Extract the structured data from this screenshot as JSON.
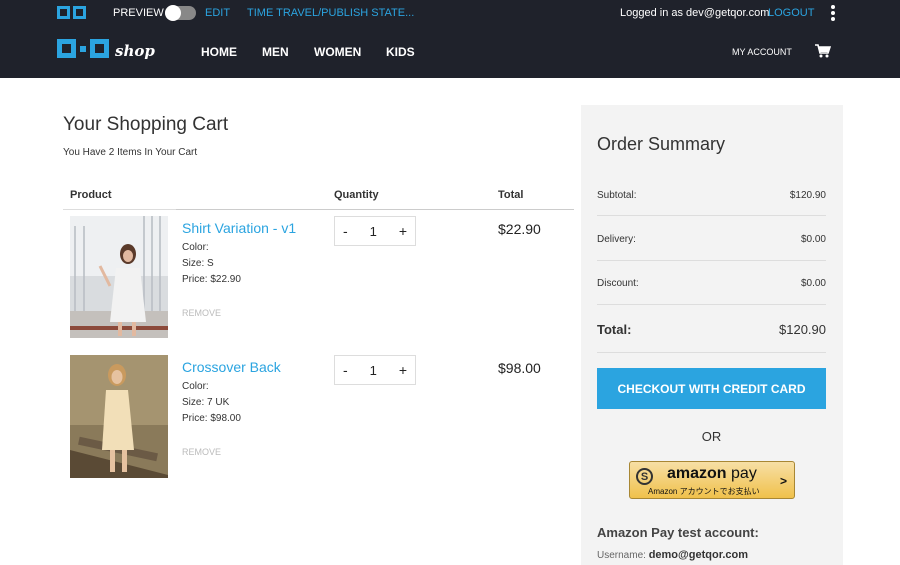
{
  "admin": {
    "preview": "PREVIEW",
    "edit": "EDIT",
    "time_travel": "TIME TRAVEL/PUBLISH STATE...",
    "logged_in": "Logged in as dev@getqor.com",
    "logout": "LOGOUT"
  },
  "nav": {
    "shop": "shop",
    "links": [
      "HOME",
      "MEN",
      "WOMEN",
      "KIDS"
    ],
    "account": "MY ACCOUNT"
  },
  "cart": {
    "title": "Your Shopping Cart",
    "subtitle": "You Have 2 Items In Your Cart",
    "headers": {
      "product": "Product",
      "quantity": "Quantity",
      "total": "Total"
    },
    "items": [
      {
        "name": "Shirt Variation - v1",
        "color": "Color:",
        "size": "Size: S",
        "price": "Price: $22.90",
        "remove": "REMOVE",
        "qty": "1",
        "total": "$22.90"
      },
      {
        "name": "Crossover Back",
        "color": "Color:",
        "size": "Size: 7 UK",
        "price": "Price: $98.00",
        "remove": "REMOVE",
        "qty": "1",
        "total": "$98.00"
      }
    ]
  },
  "summary": {
    "title": "Order Summary",
    "subtotal_label": "Subtotal:",
    "subtotal": "$120.90",
    "delivery_label": "Delivery:",
    "delivery": "$0.00",
    "discount_label": "Discount:",
    "discount": "$0.00",
    "total_label": "Total:",
    "total": "$120.90",
    "checkout": "CHECKOUT WITH CREDIT CARD",
    "or": "OR",
    "amazon_word": "amazon",
    "amazon_pay": "pay",
    "amazon_sub": "Amazon アカウントでお支払い",
    "test_account": "Amazon Pay test account:",
    "username_label": "Username:",
    "username": "demo@getqor.com"
  },
  "colors": {
    "accent": "#2ba4e0",
    "nav_bg": "#1f222b",
    "summary_bg": "#f3f3f3"
  }
}
